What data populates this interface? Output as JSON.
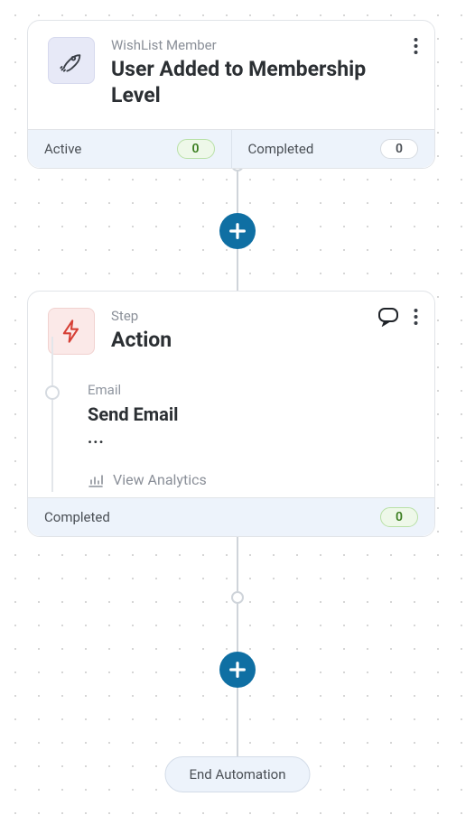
{
  "trigger": {
    "eyebrow": "WishList Member",
    "title": "User Added to Membership Level",
    "active_label": "Active",
    "active_count": "0",
    "completed_label": "Completed",
    "completed_count": "0"
  },
  "action": {
    "eyebrow": "Step",
    "title": "Action",
    "sub_eyebrow": "Email",
    "sub_title": "Send Email",
    "sub_detail": "...",
    "analytics_label": "View Analytics",
    "completed_label": "Completed",
    "completed_count": "0"
  },
  "end_label": "End Automation"
}
